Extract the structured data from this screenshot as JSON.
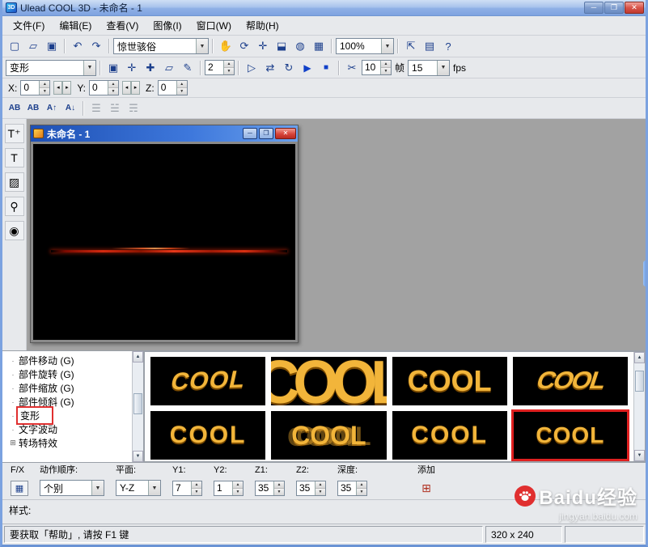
{
  "colors": {
    "accent_blue": "#1e50b4",
    "gold": "#f2b53a",
    "highlight_red": "#e02020"
  },
  "titlebar": {
    "title": "Ulead COOL 3D - 未命名 - 1"
  },
  "menu": {
    "items": [
      {
        "label": "文件(F)"
      },
      {
        "label": "编辑(E)"
      },
      {
        "label": "查看(V)"
      },
      {
        "label": "图像(I)"
      },
      {
        "label": "窗口(W)"
      },
      {
        "label": "帮助(H)"
      }
    ]
  },
  "toolbar1": {
    "file_icons": [
      {
        "name": "new-file-icon",
        "glyph": "▢"
      },
      {
        "name": "open-folder-icon",
        "glyph": "▱"
      },
      {
        "name": "save-icon",
        "glyph": "▣"
      }
    ],
    "undo_icons": [
      {
        "name": "undo-icon",
        "glyph": "↶"
      },
      {
        "name": "redo-icon",
        "glyph": "↷"
      }
    ],
    "preset_value": "惊世骇俗",
    "view_icons": [
      {
        "name": "pan-hand-icon",
        "glyph": "✋"
      },
      {
        "name": "rotate-view-icon",
        "glyph": "⟳"
      },
      {
        "name": "move-object-icon",
        "glyph": "✛"
      },
      {
        "name": "dimension-icon",
        "glyph": "⬓"
      },
      {
        "name": "globe-icon",
        "glyph": "◍"
      },
      {
        "name": "grid-table-icon",
        "glyph": "▦"
      }
    ],
    "zoom_value": "100%",
    "right_icons": [
      {
        "name": "export-icon",
        "glyph": "⇱"
      },
      {
        "name": "render-frame-icon",
        "glyph": "▤"
      },
      {
        "name": "context-help-icon",
        "glyph": "?"
      }
    ]
  },
  "toolbar2": {
    "effect_combo_value": "变形",
    "edit_icons": [
      {
        "name": "attributes-icon",
        "glyph": "▣"
      },
      {
        "name": "position-icon",
        "glyph": "✛"
      },
      {
        "name": "add-keyframe-icon",
        "glyph": "✚"
      },
      {
        "name": "slope-icon",
        "glyph": "▱"
      },
      {
        "name": "pen-icon",
        "glyph": "✎"
      }
    ],
    "frame_value": "2",
    "loop_icons": [
      {
        "name": "shape-icon",
        "glyph": "▷"
      },
      {
        "name": "swap-direction-icon",
        "glyph": "⇄"
      },
      {
        "name": "loop-icon",
        "glyph": "↻"
      }
    ],
    "play_icon": {
      "name": "play-icon",
      "glyph": "▶"
    },
    "stop_icon": {
      "name": "stop-icon",
      "glyph": "■"
    },
    "snip_icon": {
      "name": "snip-frames-icon",
      "glyph": "✂"
    },
    "frames_value": "10",
    "frames_label": "帧",
    "fps_value": "15",
    "fps_label": "fps"
  },
  "toolbar3": {
    "x_label": "X:",
    "x_value": "0",
    "y_label": "Y:",
    "y_value": "0",
    "z_label": "Z:",
    "z_value": "0",
    "nudge_left_glyph": "◂",
    "nudge_right_glyph": "▸"
  },
  "toolbar4": {
    "text_icons": [
      {
        "name": "insert-text-icon",
        "glyph": "AB"
      },
      {
        "name": "edit-text-icon",
        "glyph": "AB"
      },
      {
        "name": "split-text-up-icon",
        "glyph": "A↑"
      },
      {
        "name": "split-text-down-icon",
        "glyph": "A↓"
      }
    ],
    "align_icons": [
      {
        "name": "align-left-icon",
        "glyph": "☰"
      },
      {
        "name": "align-center-icon",
        "glyph": "☱"
      },
      {
        "name": "align-right-icon",
        "glyph": "☴"
      }
    ]
  },
  "left_strip": {
    "icons": [
      {
        "name": "insert-text-tool-icon",
        "glyph": "T⁺"
      },
      {
        "name": "edit-text-tool-icon",
        "glyph": "T"
      },
      {
        "name": "insert-image-tool-icon",
        "glyph": "▨"
      },
      {
        "name": "magnifier-tool-icon",
        "glyph": "⚲"
      },
      {
        "name": "material-sphere-tool-icon",
        "glyph": "◉"
      }
    ]
  },
  "doc_window": {
    "title": "未命名 - 1"
  },
  "tree": {
    "items": [
      {
        "bullet": "·",
        "label": "部件移动 (G)",
        "state": ""
      },
      {
        "bullet": "·",
        "label": "部件旋转 (G)",
        "state": ""
      },
      {
        "bullet": "·",
        "label": "部件缩放 (G)",
        "state": ""
      },
      {
        "bullet": "·",
        "label": "部件倾斜 (G)",
        "state": ""
      },
      {
        "bullet": "·",
        "label": "变形",
        "state": "selected"
      },
      {
        "bullet": "·",
        "label": "文字波动",
        "state": ""
      },
      {
        "bullet": "⊞",
        "label": "转场特效",
        "state": ""
      }
    ]
  },
  "thumbnails": {
    "items": [
      {
        "text": "COOL",
        "style": "t1"
      },
      {
        "text": "COOL",
        "style": "t2"
      },
      {
        "text": "COOL",
        "style": "t3"
      },
      {
        "text": "COOL",
        "style": "t4"
      },
      {
        "text": "COOL",
        "style": "t5"
      },
      {
        "text": "COOL",
        "style": "t6"
      },
      {
        "text": "COOL",
        "style": "t7"
      },
      {
        "text": "COOL",
        "style": "t8 selected"
      }
    ]
  },
  "controls": {
    "fx_label": "F/X",
    "fx_icon_glyph": "▦",
    "order_label": "动作顺序:",
    "order_value": "个别",
    "plane_label": "平面:",
    "plane_value": "Y-Z",
    "y1_label": "Y1:",
    "y1_value": "7",
    "y2_label": "Y2:",
    "y2_value": "1",
    "z1_label": "Z1:",
    "z1_value": "35",
    "z2_label": "Z2:",
    "z2_value": "35",
    "depth_label": "深度:",
    "depth_value": "35",
    "add_label": "添加",
    "add_icon_glyph": "⊞"
  },
  "style_row": {
    "label": "样式:"
  },
  "statusbar": {
    "help_text": "要获取「帮助」, 请按 F1 键",
    "size_text": "320 x 240"
  },
  "watermark": {
    "brand": "Baidu经验",
    "url": "jingyan.baidu.com"
  }
}
